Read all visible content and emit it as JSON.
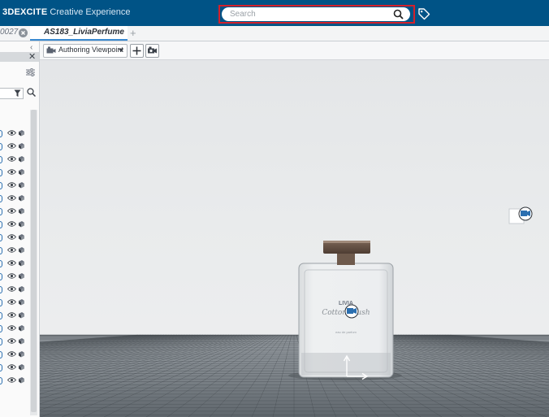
{
  "app": {
    "brand": "3DEXCITE",
    "product": "Creative Experience"
  },
  "search": {
    "placeholder": "Search"
  },
  "tabs": {
    "previous_label": "0027",
    "active_label": "AS183_LiviaPerfume",
    "add_label": "+"
  },
  "left_panel": {
    "collapse_label": "‹",
    "close_label": "✕",
    "row_count": 20
  },
  "toolbar": {
    "viewpoint_label": "Authoring Viewpoint"
  },
  "product": {
    "brand_text": "LIVIA",
    "script_text": "Cotton Blush",
    "subtext": "eau de parfum"
  },
  "icons": {
    "search": "search-icon",
    "tag": "tag-icon",
    "camera": "camera-icon",
    "add": "plus-icon",
    "camera_settings": "camera-settings-icon",
    "filter": "filter-icon",
    "eye": "eye-icon",
    "settings": "sliders-icon"
  },
  "colors": {
    "topbar": "#005386",
    "search_highlight": "#d4202b",
    "tab_accent": "#3a8ad0"
  }
}
